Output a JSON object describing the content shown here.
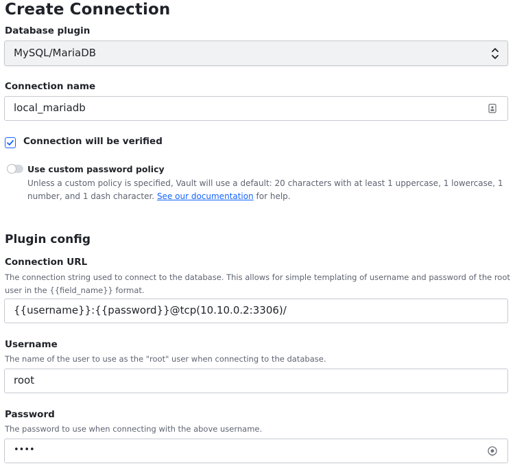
{
  "page": {
    "title": "Create Connection"
  },
  "plugin": {
    "label": "Database plugin",
    "selected": "MySQL/MariaDB"
  },
  "connection_name": {
    "label": "Connection name",
    "value": "local_mariadb"
  },
  "verify": {
    "label": "Connection will be verified",
    "checked": true
  },
  "password_policy": {
    "label": "Use custom password policy",
    "enabled": false,
    "help_prefix": "Unless a custom policy is specified, Vault will use a default: 20 characters with at least 1 uppercase, 1 lowercase, 1 number, and 1 dash character. ",
    "link_text": "See our documentation",
    "help_suffix": " for help."
  },
  "plugin_config": {
    "title": "Plugin config",
    "connection_url": {
      "label": "Connection URL",
      "help": "The connection string used to connect to the database. This allows for simple templating of username and password of the root user in the {{field_name}} format.",
      "value": "{{username}}:{{password}}@tcp(10.10.0.2:3306)/"
    },
    "username": {
      "label": "Username",
      "help": "The name of the user to use as the \"root\" user when connecting to the database.",
      "value": "root"
    },
    "password": {
      "label": "Password",
      "help": "The password to use when connecting with the above username.",
      "value": "••••"
    }
  },
  "colors": {
    "accent": "#1563ff",
    "text": "#1f2228",
    "muted": "#5d6370",
    "border": "#c6c9cf"
  },
  "icons": {
    "select_chevron": "chevron-up-down-icon",
    "name_field": "id-card-icon",
    "password_field": "eye-icon"
  }
}
